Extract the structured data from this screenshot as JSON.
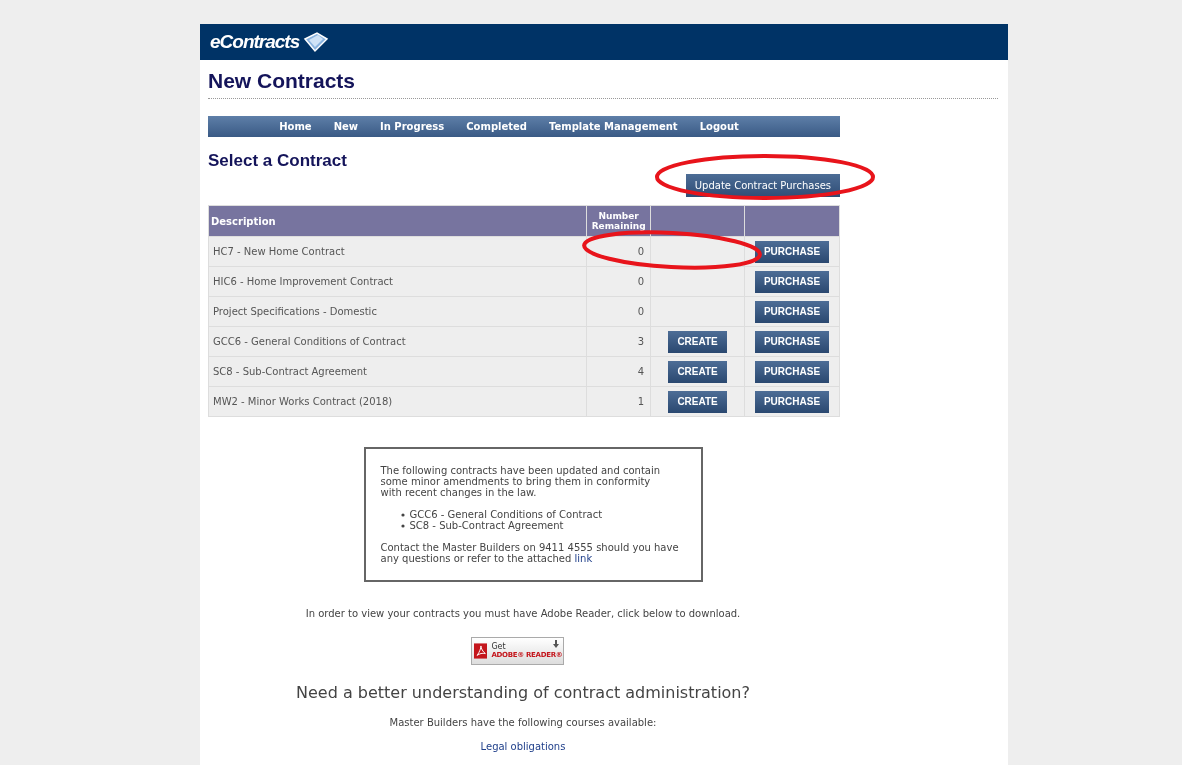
{
  "header": {
    "logo": "eContracts"
  },
  "page_title": "New Contracts",
  "nav": [
    "Home",
    "New",
    "In Progress",
    "Completed",
    "Template Management",
    "Logout"
  ],
  "section_title": "Select a Contract",
  "update_button": "Update Contract Purchases",
  "table": {
    "columns": [
      "Description",
      "Number Remaining"
    ],
    "rows": [
      {
        "description": "HC7 - New Home Contract",
        "remaining": "0",
        "purchase": "PURCHASE"
      },
      {
        "description": "HIC6 - Home Improvement Contract",
        "remaining": "0",
        "purchase": "PURCHASE"
      },
      {
        "description": "Project Specifications - Domestic",
        "remaining": "0",
        "purchase": "PURCHASE"
      },
      {
        "description": "GCC6 - General Conditions of Contract",
        "remaining": "3",
        "create": "CREATE",
        "purchase": "PURCHASE"
      },
      {
        "description": "SC8 - Sub-Contract Agreement",
        "remaining": "4",
        "create": "CREATE",
        "purchase": "PURCHASE"
      },
      {
        "description": "MW2 - Minor Works Contract (2018)",
        "remaining": "1",
        "create": "CREATE",
        "purchase": "PURCHASE"
      }
    ]
  },
  "notice": {
    "intro": "The following contracts have been updated and contain some minor amendments to bring them in conformity with recent changes in the law.",
    "items": [
      "GCC6 - General Conditions of Contract",
      "SC8 - Sub-Contract Agreement"
    ],
    "contact": "Contact the Master Builders on 9411 4555 should you have any questions or refer to the attached",
    "link": "link"
  },
  "adobe_note": "In order to view your contracts you must have Adobe Reader, click below to download.",
  "adobe_badge": {
    "line_1": "Get",
    "line_2": "ADOBE® READER®"
  },
  "courses": {
    "heading": "Need a better understanding of contract administration?",
    "subtitle": "Master Builders have the following courses available:",
    "links": [
      "Legal obligations"
    ]
  },
  "annotations": [
    {
      "kind": "ellipse"
    },
    {
      "kind": "ellipse"
    }
  ]
}
